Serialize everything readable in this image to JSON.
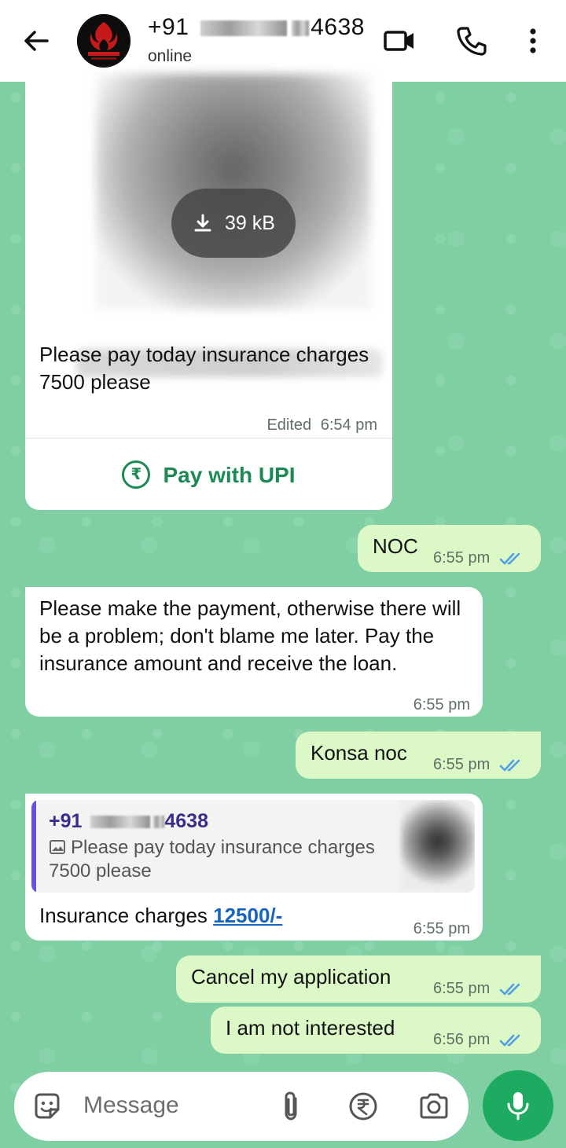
{
  "header": {
    "contact_prefix": "+91",
    "contact_suffix": "4638",
    "status": "online"
  },
  "messages": {
    "m1": {
      "media_size": "39 kB",
      "text": "Please pay today insurance charges 7500 please",
      "edited_label": "Edited",
      "time": "6:54 pm",
      "pay_label": "Pay with UPI"
    },
    "m2": {
      "text": "NOC",
      "time": "6:55 pm"
    },
    "m3": {
      "text": "Please make the payment, otherwise there will be a problem; don't blame me later. Pay the insurance amount and receive the loan.",
      "time": "6:55 pm"
    },
    "m4": {
      "text": "Konsa noc",
      "time": "6:55 pm"
    },
    "m5": {
      "quote_prefix": "+91",
      "quote_suffix": "4638",
      "quote_text": "Please pay today insurance charges 7500 please",
      "text_prefix": "Insurance charges ",
      "amount": "12500/-",
      "time": "6:55 pm"
    },
    "m6": {
      "text": "Cancel my application",
      "time": "6:55 pm"
    },
    "m7": {
      "text": "I am not interested",
      "time": "6:56 pm"
    }
  },
  "input": {
    "placeholder": "Message"
  },
  "colors": {
    "chat_background": "#7fcfa3",
    "outgoing_bubble": "#dbf8c6",
    "accent_green": "#1daa61",
    "read_ticks": "#4f9fe6"
  }
}
